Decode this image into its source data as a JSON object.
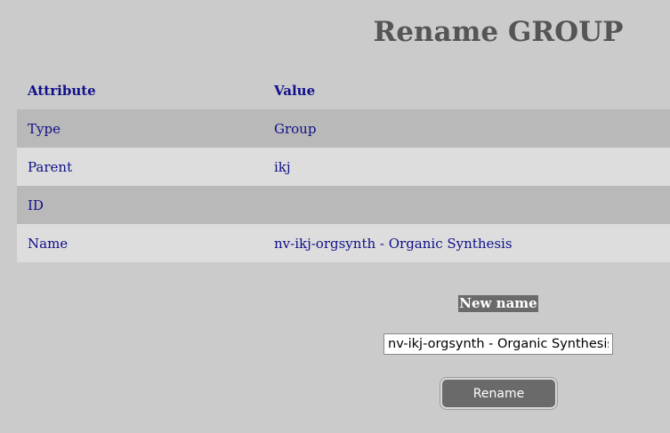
{
  "page": {
    "title": "Rename GROUP"
  },
  "table": {
    "headers": {
      "attribute": "Attribute",
      "value": "Value"
    },
    "rows": [
      {
        "attribute": "Type",
        "value": "Group"
      },
      {
        "attribute": "Parent",
        "value": "ikj"
      },
      {
        "attribute": "ID",
        "value": ""
      },
      {
        "attribute": "Name",
        "value": "nv-ikj-orgsynth - Organic Synthesis"
      }
    ]
  },
  "form": {
    "label": "New name",
    "input_value": "nv-ikj-orgsynth - Organic Synthesis",
    "button_label": "Rename"
  },
  "colors": {
    "background": "#cbcbcb",
    "title": "#555555",
    "link_text": "#10108a",
    "row_dark": "#b9b9b9",
    "row_light": "#dddddd",
    "button": "#6a6a6a"
  }
}
